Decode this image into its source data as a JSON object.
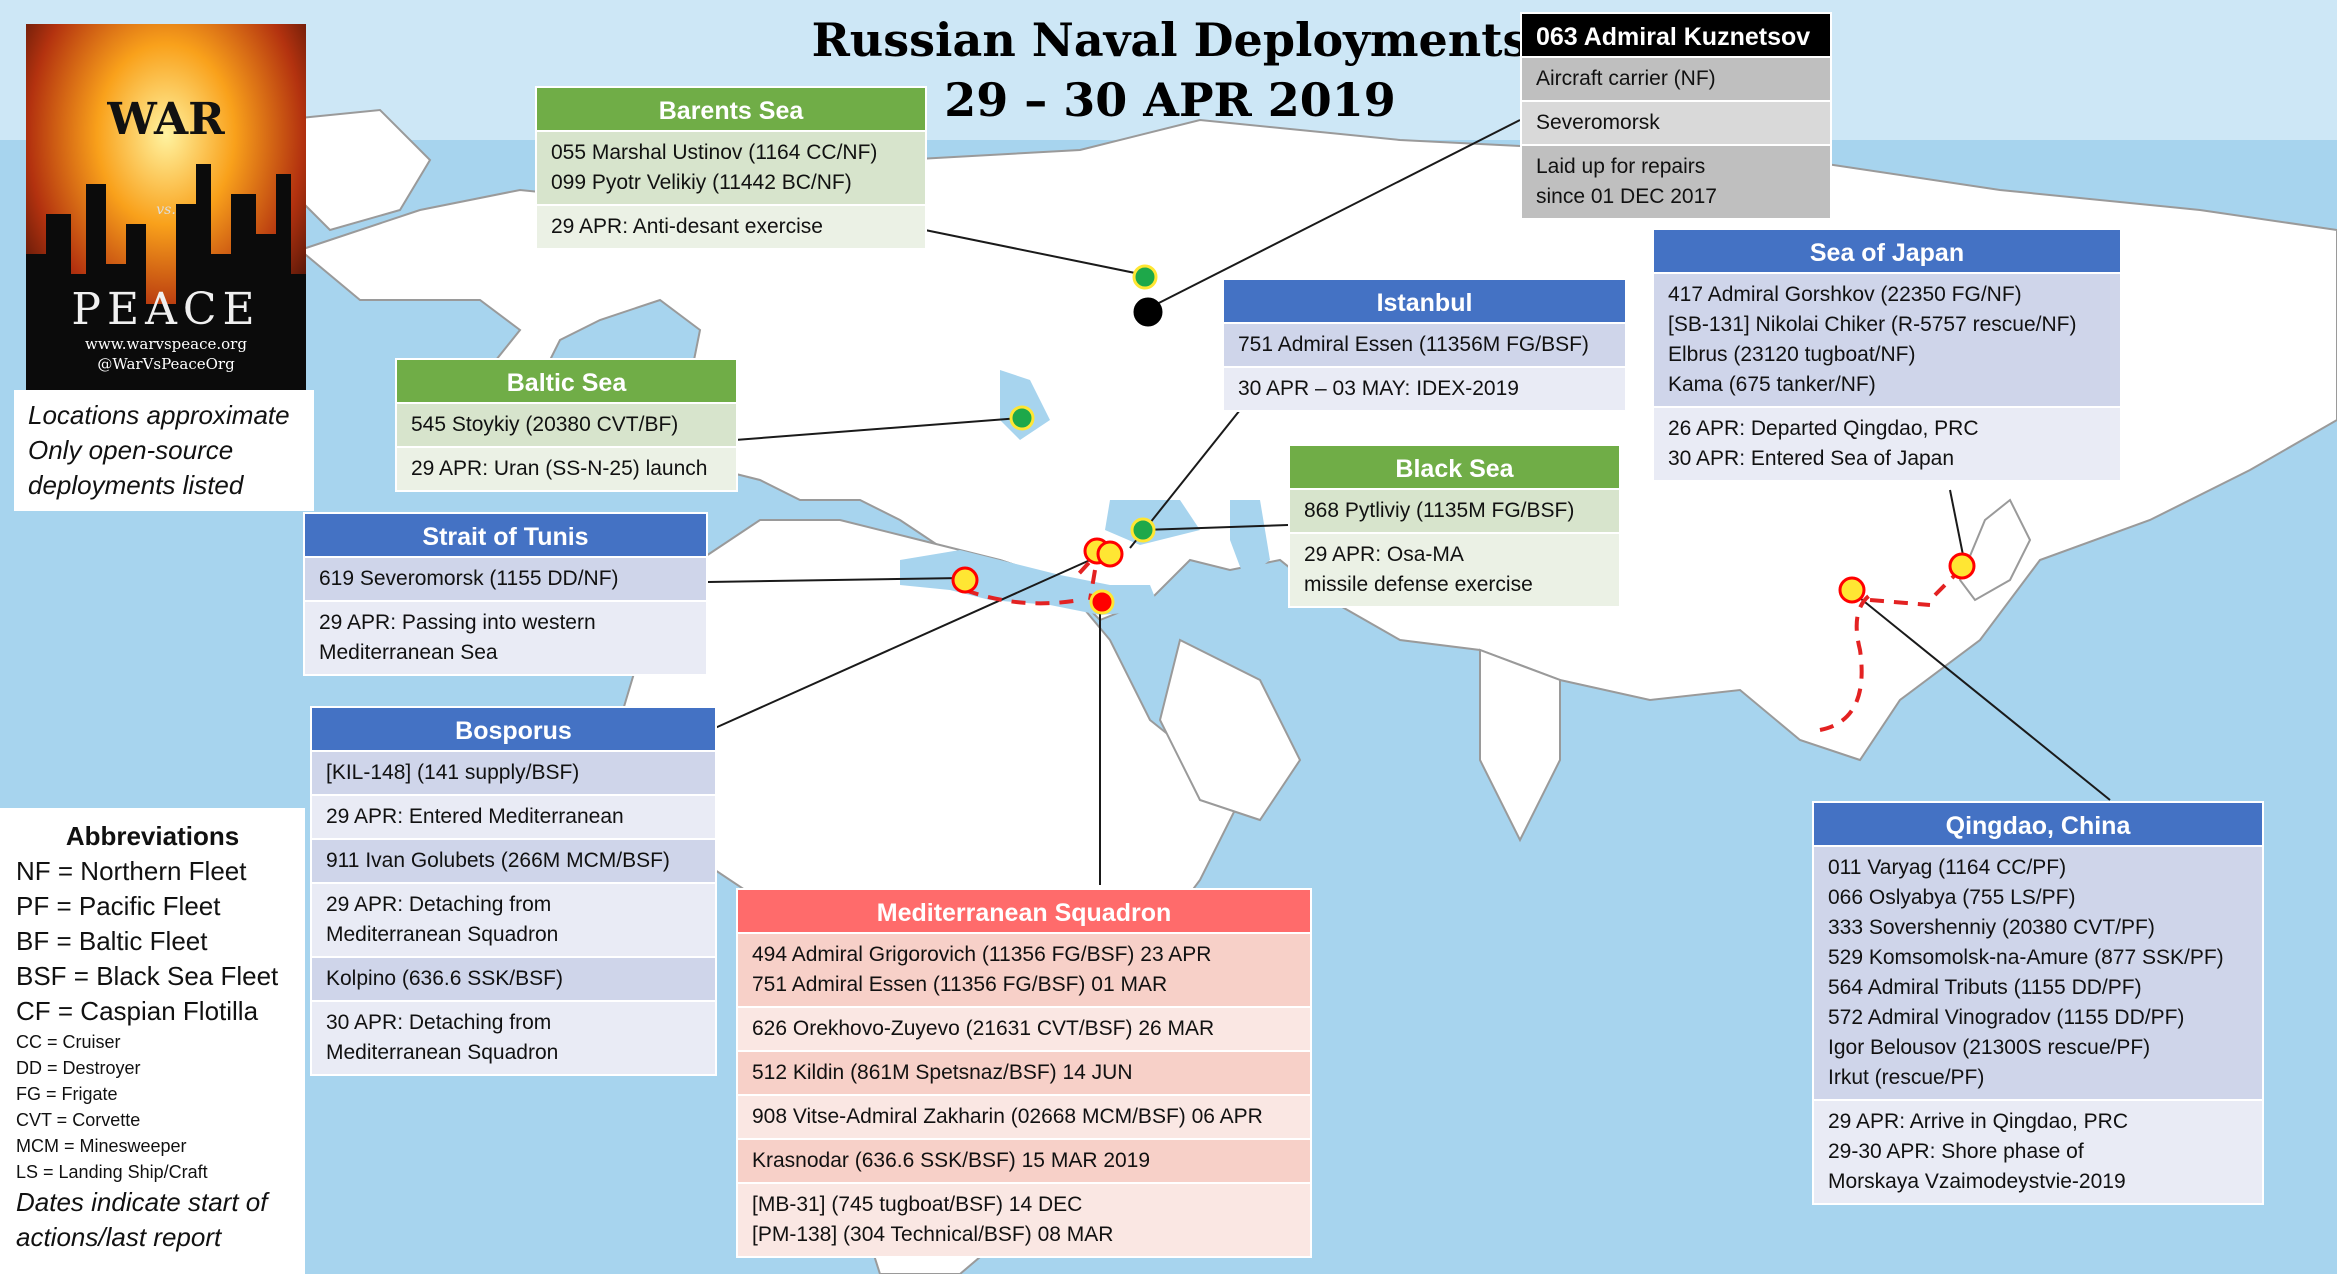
{
  "title": {
    "line1": "Russian Naval Deployments",
    "line2": "29 – 30 APR 2019"
  },
  "colors": {
    "ocean": "#a7d4ee",
    "land": "#ffffff",
    "border": "#9a9a9a",
    "green": "#70ad47",
    "blue": "#4472c4",
    "red": "#ff6b6b",
    "black": "#000000",
    "marker_yellow": "#ffe633",
    "marker_red": "#ff0000",
    "marker_green": "#1ea84a"
  },
  "logo": {
    "war": "WAR",
    "vs": "vs.",
    "peace": "PEACE",
    "site": "www.warvspeace.org",
    "handle": "@WarVsPeaceOrg"
  },
  "notes": {
    "line1": "Locations approximate",
    "line2": "Only open-source",
    "line3": "deployments listed"
  },
  "abbreviations": {
    "title": "Abbreviations",
    "major": [
      "NF = Northern Fleet",
      "PF = Pacific Fleet",
      "BF = Baltic Fleet",
      "BSF = Black Sea Fleet",
      "CF = Caspian Flotilla"
    ],
    "minor": [
      "CC = Cruiser",
      "DD = Destroyer",
      "FG = Frigate",
      "CVT = Corvette",
      "MCM = Minesweeper",
      "LS = Landing Ship/Craft"
    ],
    "footer": "Dates indicate start of actions/last report"
  },
  "panels": {
    "barents": {
      "header": "Barents Sea",
      "rows": [
        "055 Marshal Ustinov (1164 CC/NF)\n099 Pyotr Velikiy (11442 BC/NF)",
        "29 APR: Anti-desant exercise"
      ]
    },
    "kuznetsov": {
      "header": "063 Admiral Kuznetsov",
      "rows": [
        "Aircraft carrier (NF)",
        "Severomorsk",
        "Laid up for repairs\nsince 01 DEC 2017"
      ]
    },
    "baltic": {
      "header": "Baltic Sea",
      "rows": [
        "545 Stoykiy (20380 CVT/BF)",
        "29 APR: Uran (SS-N-25) launch"
      ]
    },
    "istanbul": {
      "header": "Istanbul",
      "rows": [
        "751 Admiral Essen (11356M FG/BSF)",
        "30 APR – 03 MAY: IDEX-2019"
      ]
    },
    "sea_of_japan": {
      "header": "Sea of Japan",
      "rows": [
        "417 Admiral Gorshkov (22350 FG/NF)\n[SB-131] Nikolai Chiker (R-5757 rescue/NF)\nElbrus (23120 tugboat/NF)\nKama (675 tanker/NF)",
        "26 APR: Departed Qingdao, PRC\n30 APR: Entered Sea of Japan"
      ]
    },
    "black_sea": {
      "header": "Black Sea",
      "rows": [
        "868 Pytliviy (1135M FG/BSF)",
        "29 APR: Osa-MA\nmissile defense exercise"
      ]
    },
    "tunis": {
      "header": "Strait of Tunis",
      "rows": [
        "619 Severomorsk (1155 DD/NF)",
        "29 APR: Passing into western\nMediterranean Sea"
      ]
    },
    "bosporus": {
      "header": "Bosporus",
      "rows": [
        "[KIL-148] (141 supply/BSF)",
        "29 APR: Entered Mediterranean",
        "911 Ivan Golubets (266M MCM/BSF)",
        "29 APR: Detaching from\nMediterranean Squadron",
        "Kolpino (636.6 SSK/BSF)",
        "30 APR: Detaching from\nMediterranean Squadron"
      ]
    },
    "med": {
      "header": "Mediterranean Squadron",
      "rows": [
        "494 Admiral Grigorovich (11356 FG/BSF) 23 APR\n751 Admiral Essen (11356 FG/BSF) 01 MAR",
        "626 Orekhovo-Zuyevo (21631 CVT/BSF) 26 MAR",
        "512 Kildin (861M Spetsnaz/BSF) 14 JUN",
        "908 Vitse-Admiral Zakharin (02668 MCM/BSF) 06 APR",
        "Krasnodar (636.6 SSK/BSF) 15 MAR 2019",
        "[MB-31] (745 tugboat/BSF) 14 DEC\n[PM-138] (304 Technical/BSF) 08 MAR"
      ]
    },
    "qingdao": {
      "header": "Qingdao, China",
      "rows": [
        "011 Varyag (1164 CC/PF)\n066 Oslyabya (755 LS/PF)\n333 Sovershenniy (20380 CVT/PF)\n529 Komsomolsk-na-Amure (877 SSK/PF)\n564 Admiral Tributs (1155 DD/PF)\n572 Admiral Vinogradov (1155 DD/PF)\nIgor Belousov (21300S rescue/PF)\nIrkut (rescue/PF)",
        "29 APR: Arrive in Qingdao, PRC\n29-30 APR: Shore phase of\nMorskaya Vzaimodeystvie-2019"
      ]
    }
  }
}
